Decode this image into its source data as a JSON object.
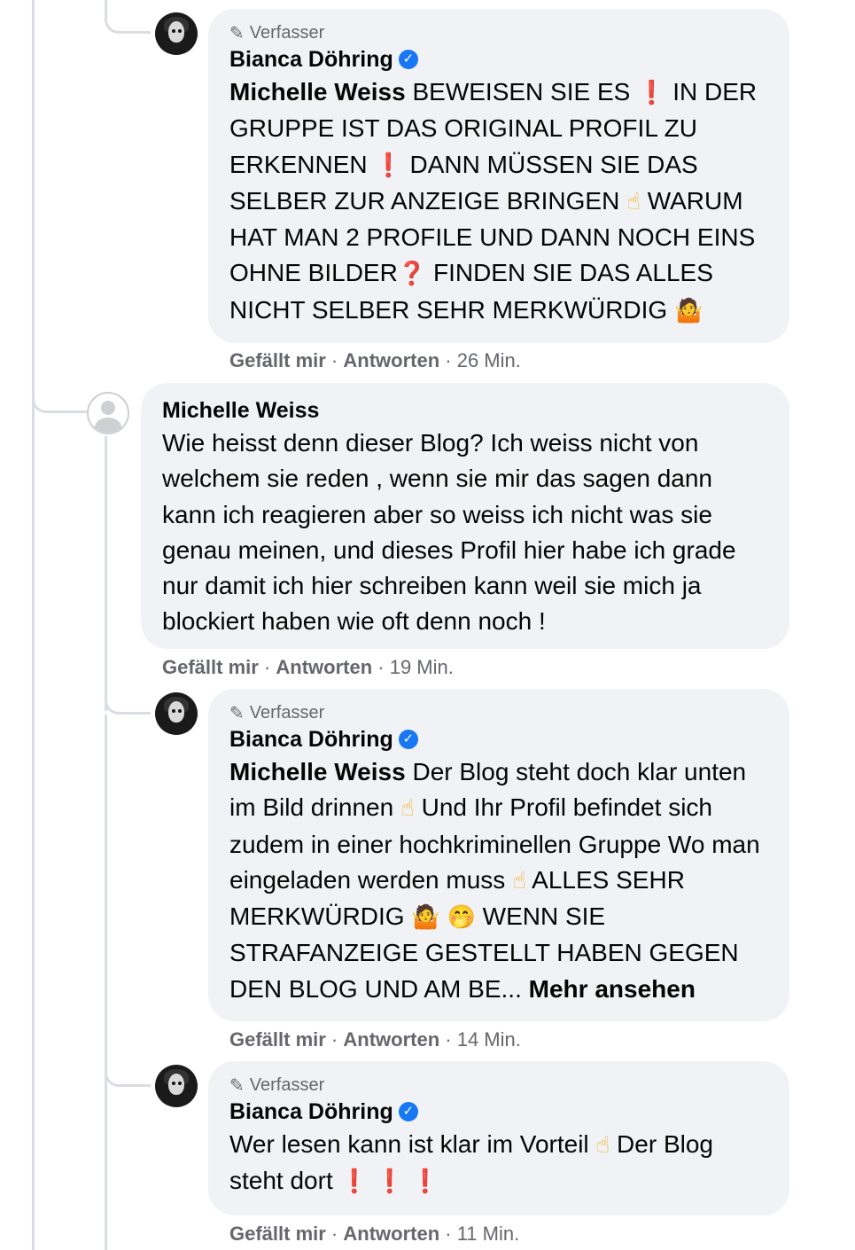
{
  "author_badge_label": "Verfasser",
  "comments": [
    {
      "author": "Bianca Döhring",
      "verified": true,
      "is_author": true,
      "mention": "Michelle Weiss",
      "text_parts": [
        " BEWEISEN SIE ES ",
        "❗",
        " IN DER GRUPPE IST DAS ORIGINAL PROFIL ZU ERKENNEN ",
        "❗",
        " DANN MÜSSEN SIE DAS SELBER ZUR ANZEIGE BRINGEN ",
        "☝",
        " WARUM HAT MAN 2 PROFILE UND DANN NOCH EINS OHNE BILDER",
        "❓",
        " FINDEN SIE DAS ALLES NICHT SELBER SEHR MERKWÜRDIG ",
        "🤷"
      ],
      "like": "Gefällt mir",
      "reply": "Antworten",
      "time": "26 Min."
    },
    {
      "author": "Michelle Weiss",
      "verified": false,
      "is_author": false,
      "text": "Wie heisst denn dieser Blog? Ich weiss nicht von welchem sie reden , wenn sie mir das sagen dann kann ich reagieren aber so weiss ich nicht was sie genau meinen, und dieses Profil hier habe ich grade nur damit ich hier schreiben kann weil sie mich ja blockiert haben wie oft denn noch !",
      "like": "Gefällt mir",
      "reply": "Antworten",
      "time": "19 Min."
    },
    {
      "author": "Bianca Döhring",
      "verified": true,
      "is_author": true,
      "mention": "Michelle Weiss",
      "text_parts": [
        " Der Blog steht doch klar unten im Bild drinnen ",
        "☝",
        " Und Ihr Profil befindet sich zudem in einer hochkriminellen Gruppe Wo man eingeladen werden muss ",
        "☝",
        " ALLES SEHR MERKWÜRDIG ",
        "🤷",
        " ",
        "🤭",
        " WENN SIE STRAFANZEIGE GESTELLT HABEN GEGEN DEN BLOG UND AM BE... "
      ],
      "see_more": "Mehr ansehen",
      "like": "Gefällt mir",
      "reply": "Antworten",
      "time": "14 Min."
    },
    {
      "author": "Bianca Döhring",
      "verified": true,
      "is_author": true,
      "text_parts": [
        "Wer lesen kann ist klar im Vorteil ",
        "☝",
        " Der Blog steht dort ",
        "❗",
        " ",
        "❗",
        " ",
        "❗"
      ],
      "like": "Gefällt mir",
      "reply": "Antworten",
      "time": "11 Min."
    }
  ],
  "colors": {
    "bubble_bg": "#f0f2f5",
    "meta_text": "#65676b",
    "verified_badge": "#1877f2",
    "thread_line": "#dadde1"
  }
}
